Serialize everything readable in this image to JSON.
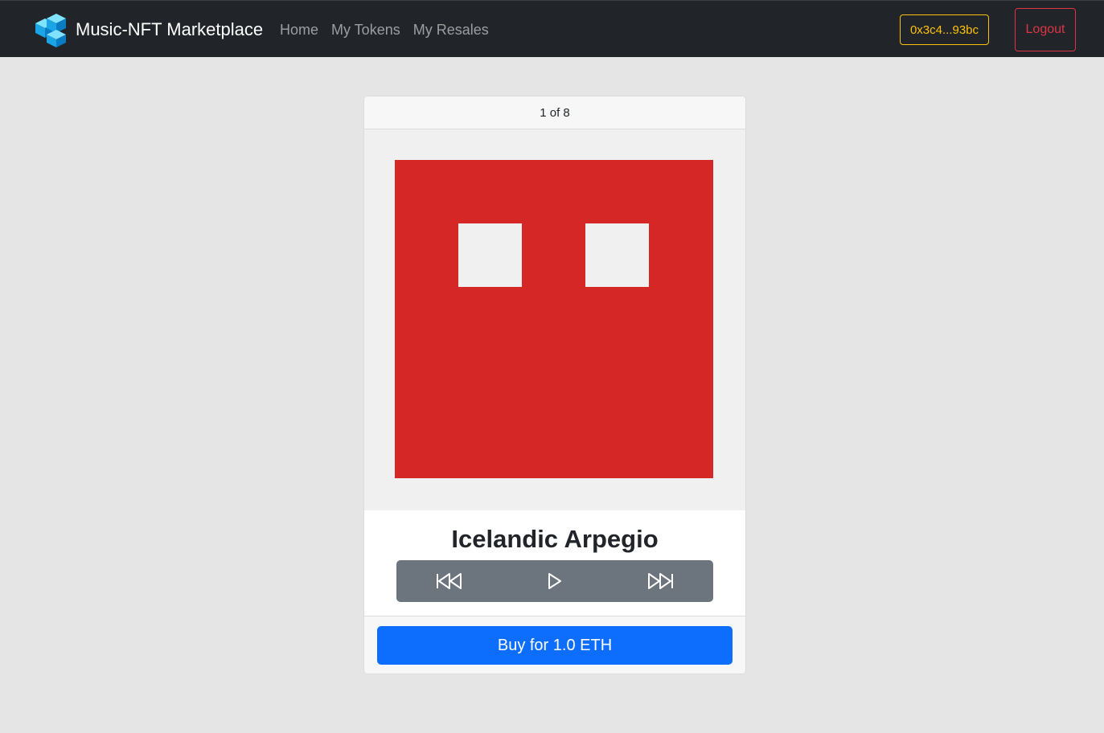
{
  "navbar": {
    "brand": "Music-NFT Marketplace",
    "brand_icon": "cubes-logo-icon",
    "links": [
      "Home",
      "My Tokens",
      "My Resales"
    ],
    "account": "0x3c4...93bc",
    "logout": "Logout"
  },
  "card": {
    "counter": "1 of 8",
    "title": "Icelandic Arpegio",
    "player_icons": [
      "skip-back-icon",
      "play-icon",
      "skip-forward-icon"
    ],
    "buy_label": "Buy for 1.0 ETH"
  },
  "colors": {
    "navbar_bg": "#212529",
    "account_accent": "#ffc107",
    "logout_accent": "#dc3545",
    "identicon": "#d62727",
    "player_bg": "#6c757d",
    "buy_bg": "#0d6efd"
  }
}
